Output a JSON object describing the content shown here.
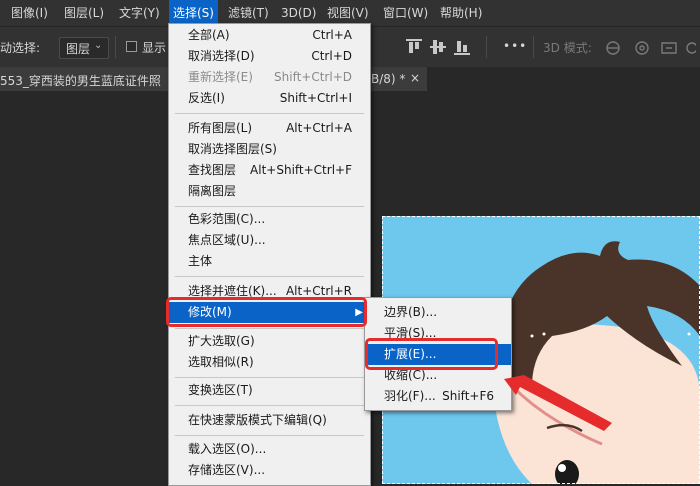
{
  "menubar": {
    "items": [
      "图像(I)",
      "图层(L)",
      "文字(Y)",
      "选择(S)",
      "滤镜(T)",
      "3D(D)",
      "视图(V)",
      "窗口(W)",
      "帮助(H)"
    ]
  },
  "options": {
    "auto_select_label": "动选择:",
    "layer_select_value": "图层",
    "show_label": "显示",
    "more_label": "•••",
    "mode_3d_label": "3D 模式:"
  },
  "tab": {
    "title_left": "553_穿西装的男生蓝底证件照",
    "title_right": "B/8) *",
    "close": "×"
  },
  "select_menu": {
    "groups": [
      [
        {
          "label": "全部(A)",
          "shortcut": "Ctrl+A",
          "enabled": true
        },
        {
          "label": "取消选择(D)",
          "shortcut": "Ctrl+D",
          "enabled": true
        },
        {
          "label": "重新选择(E)",
          "shortcut": "Shift+Ctrl+D",
          "enabled": false
        },
        {
          "label": "反选(I)",
          "shortcut": "Shift+Ctrl+I",
          "enabled": true
        }
      ],
      [
        {
          "label": "所有图层(L)",
          "shortcut": "Alt+Ctrl+A",
          "enabled": true
        },
        {
          "label": "取消选择图层(S)",
          "shortcut": "",
          "enabled": true
        },
        {
          "label": "查找图层",
          "shortcut": "Alt+Shift+Ctrl+F",
          "enabled": true
        },
        {
          "label": "隔离图层",
          "shortcut": "",
          "enabled": true
        }
      ],
      [
        {
          "label": "色彩范围(C)...",
          "shortcut": "",
          "enabled": true
        },
        {
          "label": "焦点区域(U)...",
          "shortcut": "",
          "enabled": true
        },
        {
          "label": "主体",
          "shortcut": "",
          "enabled": true
        }
      ],
      [
        {
          "label": "选择并遮住(K)...",
          "shortcut": "Alt+Ctrl+R",
          "enabled": true
        },
        {
          "label": "修改(M)",
          "shortcut": "",
          "enabled": true,
          "submenu": true,
          "highlighted": true
        }
      ],
      [
        {
          "label": "扩大选取(G)",
          "shortcut": "",
          "enabled": true
        },
        {
          "label": "选取相似(R)",
          "shortcut": "",
          "enabled": true
        }
      ],
      [
        {
          "label": "变换选区(T)",
          "shortcut": "",
          "enabled": true
        }
      ],
      [
        {
          "label": "在快速蒙版模式下编辑(Q)",
          "shortcut": "",
          "enabled": true
        }
      ],
      [
        {
          "label": "载入选区(O)...",
          "shortcut": "",
          "enabled": true
        },
        {
          "label": "存储选区(V)...",
          "shortcut": "",
          "enabled": true
        }
      ]
    ]
  },
  "modify_submenu": {
    "items": [
      {
        "label": "边界(B)...",
        "shortcut": ""
      },
      {
        "label": "平滑(S)...",
        "shortcut": ""
      },
      {
        "label": "扩展(E)...",
        "shortcut": "",
        "highlighted": true
      },
      {
        "label": "收缩(C)...",
        "shortcut": ""
      },
      {
        "label": "羽化(F)...",
        "shortcut": "Shift+F6"
      }
    ]
  },
  "colors": {
    "accent": "#0a64c8",
    "annotation_red": "#e52b2b",
    "photo_bg": "#6ec8ee",
    "hair": "#4a3328",
    "skin": "#fbe4d6"
  }
}
